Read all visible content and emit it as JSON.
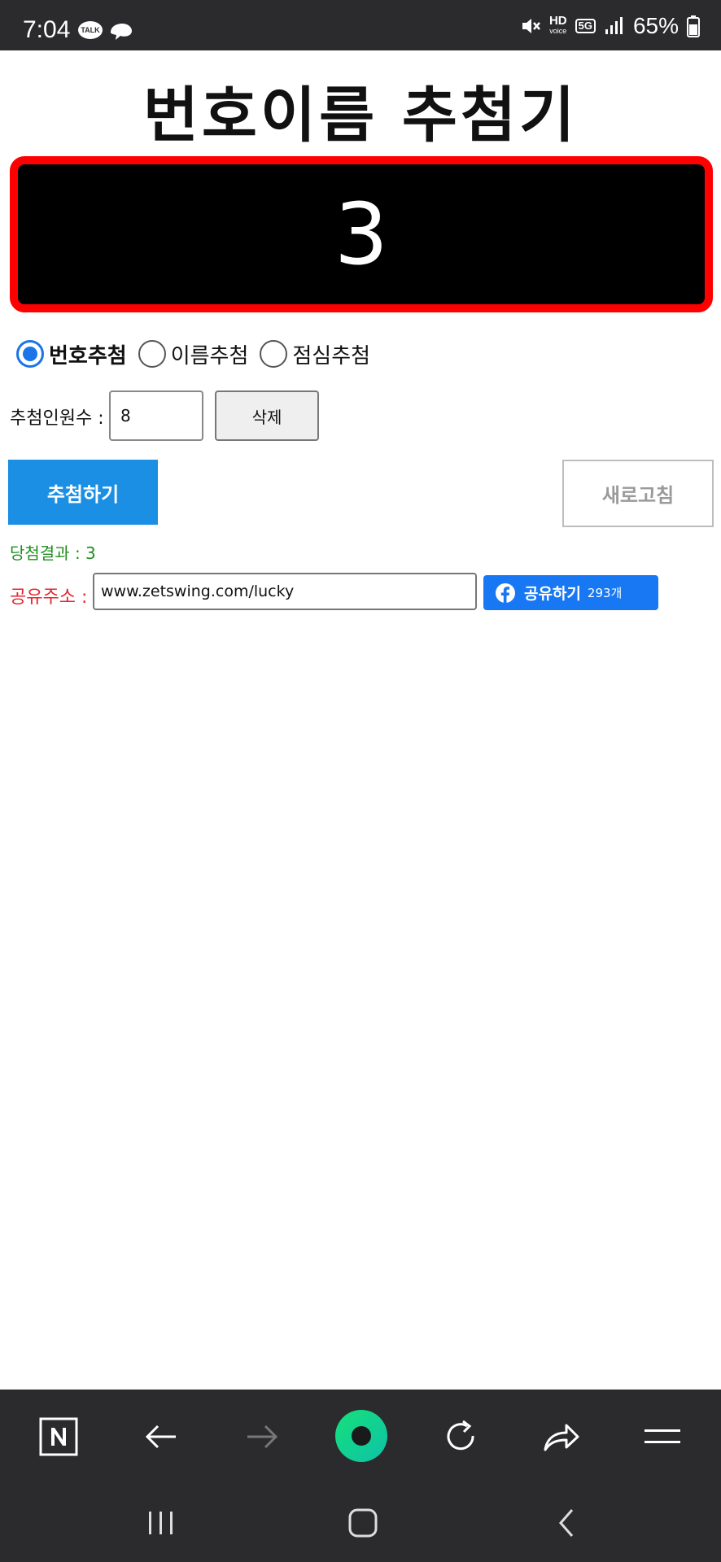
{
  "status": {
    "time": "7:04",
    "talk_badge": "TALK",
    "hd_label": "HD",
    "voice_label": "voice",
    "network": "5G",
    "battery": "65%"
  },
  "title": "번호이름 추첨기",
  "display": {
    "number": "3"
  },
  "modes": [
    {
      "label": "번호추첨",
      "selected": true
    },
    {
      "label": "이름추첨",
      "selected": false
    },
    {
      "label": "점심추첨",
      "selected": false
    }
  ],
  "count": {
    "label": "추첨인원수 :",
    "value": "8"
  },
  "buttons": {
    "delete": "삭제",
    "draw": "추첨하기",
    "refresh": "새로고침"
  },
  "result": {
    "text": "당첨결과 : 3"
  },
  "share": {
    "label": "공유주소 :",
    "url": "www.zetswing.com/lucky",
    "fb_label": "공유하기",
    "fb_count": "293개"
  },
  "colors": {
    "display_border": "#ff0000",
    "draw_button": "#1a8fe3",
    "result_text": "#1f8f1f",
    "share_label": "#e3262d",
    "facebook": "#1877f2",
    "browser_green": "#1ed47a"
  },
  "browser_toolbar": {
    "icons": [
      "naver-n-icon",
      "back-arrow-icon",
      "forward-arrow-icon",
      "home-circle-icon",
      "reload-icon",
      "share-arrow-icon",
      "menu-icon"
    ]
  },
  "navigation": {
    "icons": [
      "recent-apps-icon",
      "home-icon",
      "back-icon"
    ]
  }
}
